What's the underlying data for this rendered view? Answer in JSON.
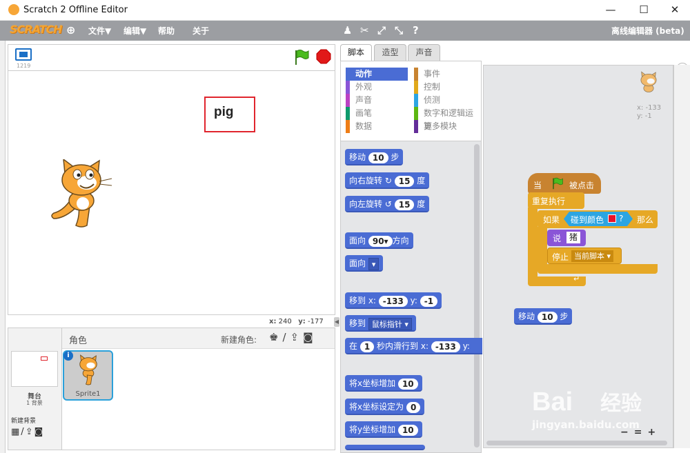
{
  "window": {
    "title": "Scratch 2 Offline Editor",
    "minimize": "—",
    "maximize": "☐",
    "close": "✕"
  },
  "menubar": {
    "logo": "SCRATCH",
    "file": "文件▼",
    "edit": "编辑▼",
    "help": "帮助",
    "about": "关于",
    "edition": "离线编辑器 (beta)"
  },
  "stage": {
    "version": "1219",
    "label_text": "pig",
    "mouse_x_label": "x:",
    "mouse_x": "240",
    "mouse_y_label": "y:",
    "mouse_y": "-177"
  },
  "sprites": {
    "header": "角色",
    "new_sprite_label": "新建角色:",
    "stage_label": "舞台",
    "stage_backdrops": "1 背景",
    "new_backdrop_label": "新建背景",
    "sprite_name": "Sprite1"
  },
  "tabs": [
    "脚本",
    "造型",
    "声音"
  ],
  "categories": {
    "left": [
      "动作",
      "外观",
      "声音",
      "画笔",
      "数据"
    ],
    "right": [
      "事件",
      "控制",
      "侦测",
      "数字和逻辑运算",
      "更多模块"
    ],
    "colors_left": [
      "#4a6cd4",
      "#8a55d7",
      "#bb42c3",
      "#0e9a6c",
      "#ee7d16"
    ],
    "colors_right": [
      "#c88330",
      "#e1a91a",
      "#2ca5e2",
      "#5cb712",
      "#632d99"
    ]
  },
  "blocks": {
    "move": {
      "a": "移动",
      "v": "10",
      "b": "步"
    },
    "turn_right": {
      "a": "向右旋转",
      "icon": "↻",
      "v": "15",
      "b": "度"
    },
    "turn_left": {
      "a": "向左旋转",
      "icon": "↺",
      "v": "15",
      "b": "度"
    },
    "point_dir": {
      "a": "面向",
      "v": "90▾",
      "b": "方向"
    },
    "point_towards": {
      "a": "面向",
      "v": "▾"
    },
    "goto_xy": {
      "a": "移到 x:",
      "x": "-133",
      "b": "y:",
      "y": "-1"
    },
    "goto": {
      "a": "移到",
      "v": "鼠标指针 ▾"
    },
    "glide": {
      "a": "在",
      "s": "1",
      "b": "秒内滑行到 x:",
      "x": "-133",
      "c": "y:"
    },
    "change_x": {
      "a": "将x坐标增加",
      "v": "10"
    },
    "set_x": {
      "a": "将x坐标设定为",
      "v": "0"
    },
    "change_y": {
      "a": "将y坐标增加",
      "v": "10"
    }
  },
  "script": {
    "sprite_x": "x: -133",
    "sprite_y": "y: -1",
    "hat_a": "当",
    "hat_b": "被点击",
    "forever": "重复执行",
    "if_a": "如果",
    "touching": "碰到颜色",
    "touching_q": "?",
    "if_b": "那么",
    "say": "说",
    "say_v": "猪",
    "stop": "停止",
    "stop_v": "当前脚本 ▾",
    "loose_move_a": "移动",
    "loose_move_v": "10",
    "loose_move_b": "步"
  },
  "watermark": {
    "brand": "Bai",
    "brand_cn": "经验",
    "url": "jingyan.baidu.com"
  },
  "colors": {
    "menubar": "#9c9ea2",
    "motion": "#4a6cd4",
    "control": "#e6a826",
    "events": "#c88330",
    "looks": "#8a55d7",
    "sensing": "#2ca5e2",
    "touch_color": "#e8132a"
  }
}
